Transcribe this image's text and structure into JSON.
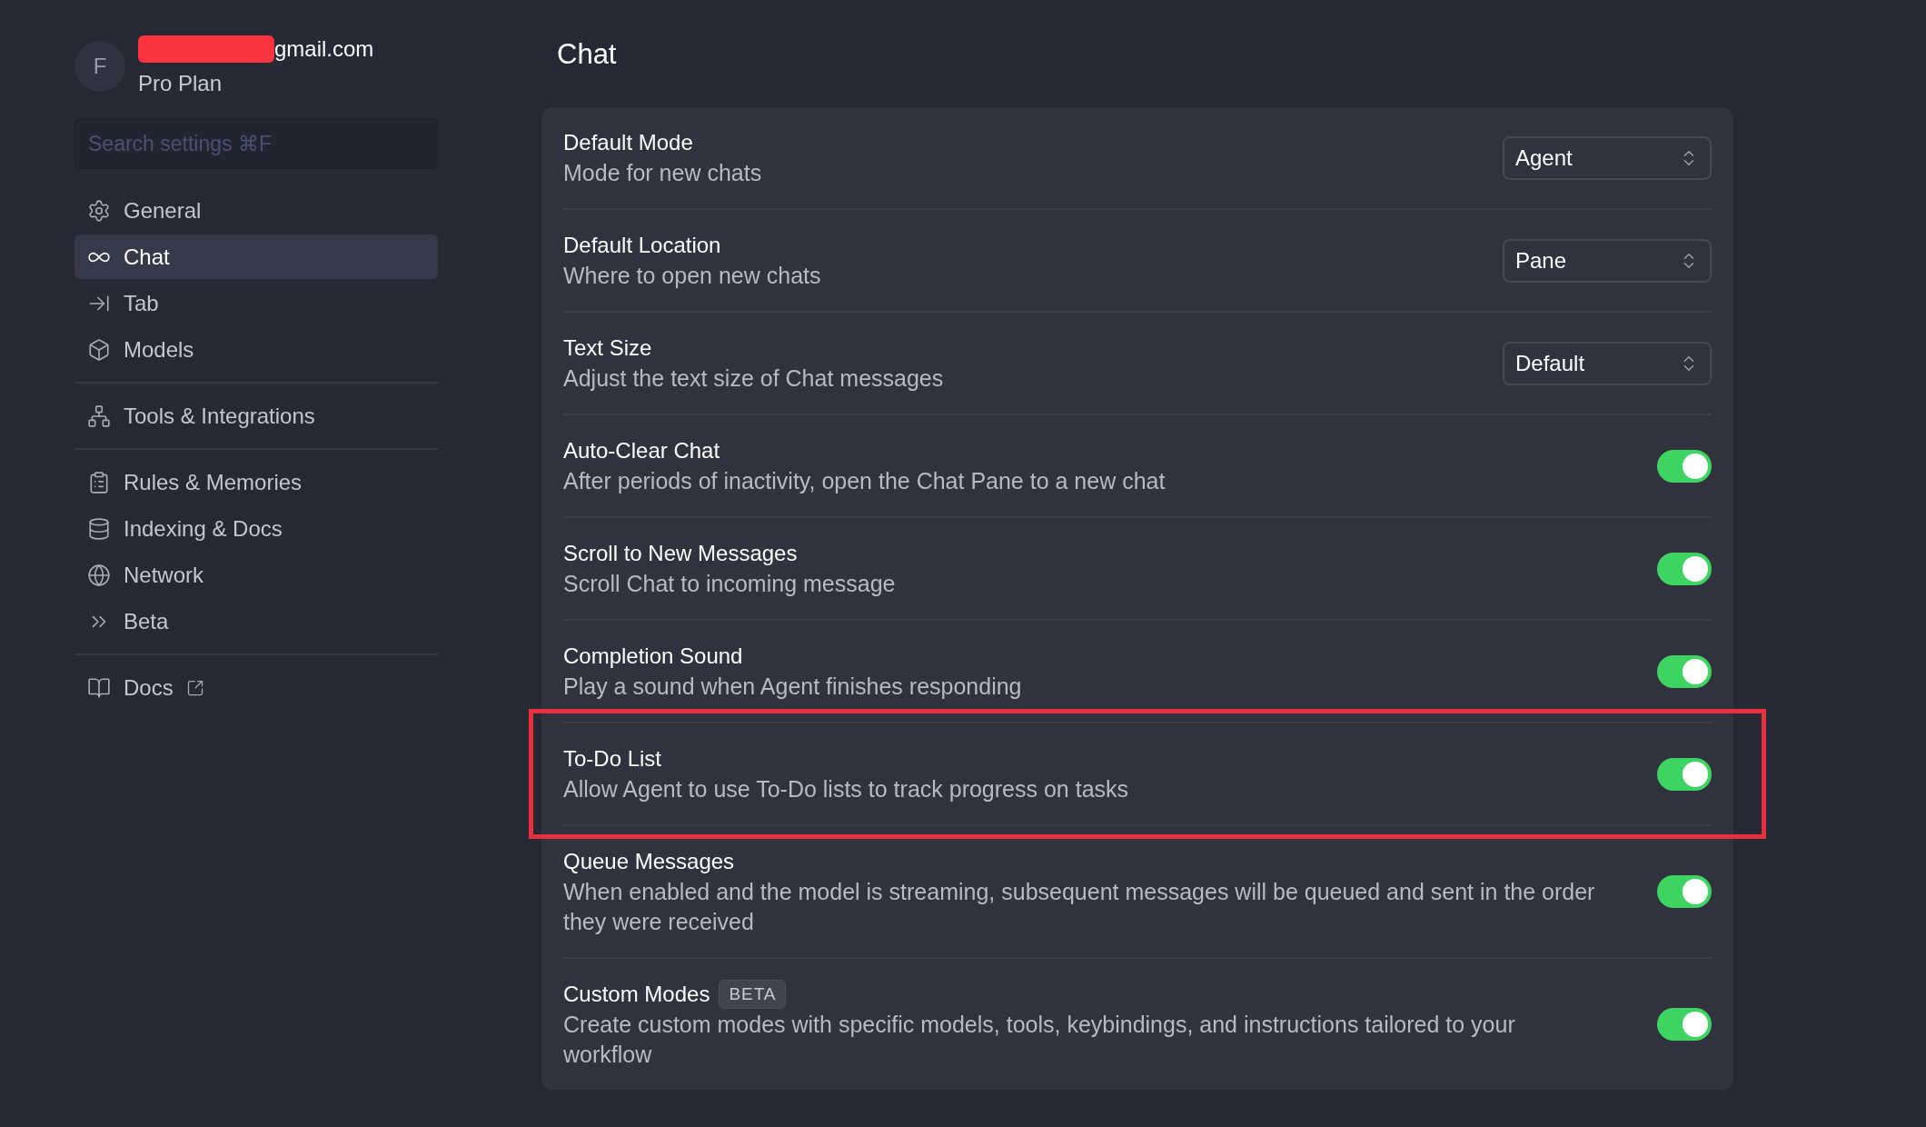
{
  "account": {
    "avatar": "F",
    "email": "gmail.com",
    "redacted": true,
    "plan": "Pro Plan"
  },
  "search": {
    "placeholder": "Search settings ⌘F"
  },
  "sidebar": {
    "groups": [
      [
        {
          "label": "General",
          "selected": false
        },
        {
          "label": "Chat",
          "selected": true
        },
        {
          "label": "Tab",
          "selected": false
        },
        {
          "label": "Models",
          "selected": false
        }
      ],
      [
        {
          "label": "Tools & Integrations",
          "selected": false
        }
      ],
      [
        {
          "label": "Rules & Memories",
          "selected": false
        },
        {
          "label": "Indexing & Docs",
          "selected": false
        },
        {
          "label": "Network",
          "selected": false
        },
        {
          "label": "Beta",
          "selected": false
        }
      ],
      [
        {
          "label": "Docs",
          "selected": false,
          "external": true
        }
      ]
    ]
  },
  "page": {
    "title": "Chat"
  },
  "settings": [
    {
      "kind": "select",
      "title": "Default Mode",
      "description": "Mode for new chats",
      "value": "Agent"
    },
    {
      "kind": "select",
      "title": "Default Location",
      "description": "Where to open new chats",
      "value": "Pane"
    },
    {
      "kind": "select",
      "title": "Text Size",
      "description": "Adjust the text size of Chat messages",
      "value": "Default"
    },
    {
      "kind": "toggle",
      "title": "Auto-Clear Chat",
      "description": "After periods of inactivity, open the Chat Pane to a new chat",
      "on": true
    },
    {
      "kind": "toggle",
      "title": "Scroll to New Messages",
      "description": "Scroll Chat to incoming message",
      "on": true
    },
    {
      "kind": "toggle",
      "title": "Completion Sound",
      "description": "Play a sound when Agent finishes responding",
      "on": true
    },
    {
      "kind": "toggle",
      "title": "To-Do List",
      "description": "Allow Agent to use To-Do lists to track progress on tasks",
      "on": true,
      "highlighted": true
    },
    {
      "kind": "toggle",
      "title": "Queue Messages",
      "description": "When enabled and the model is streaming, subsequent messages will be queued and sent in the order they were received",
      "on": true
    },
    {
      "kind": "toggle",
      "title": "Custom Modes",
      "badge": "BETA",
      "description": "Create custom modes with specific models, tools, keybindings, and instructions tailored to your workflow",
      "on": true
    }
  ]
}
